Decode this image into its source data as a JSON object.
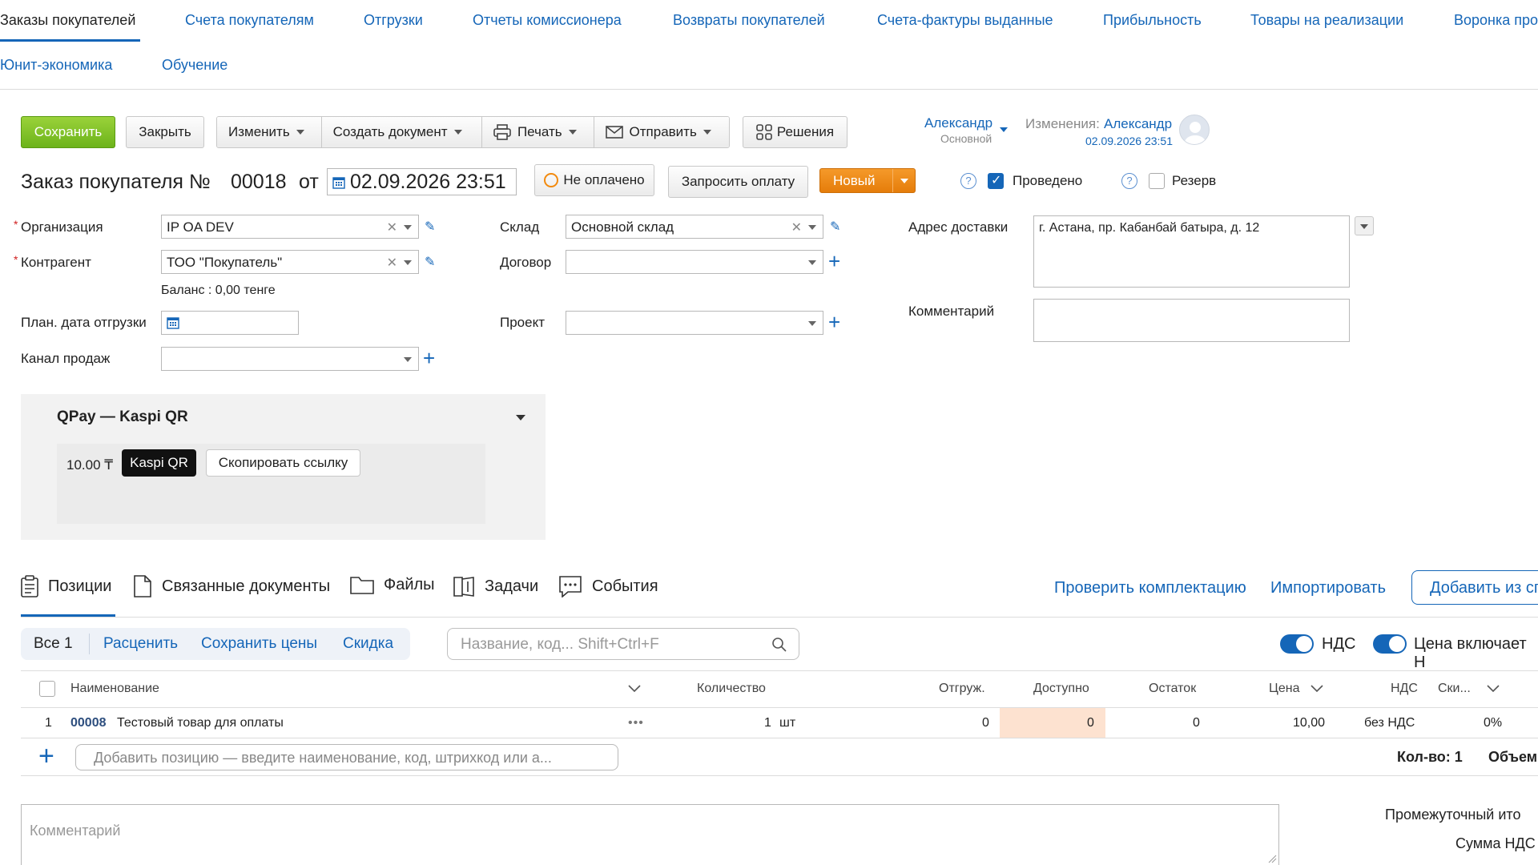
{
  "nav": {
    "row1": [
      "Заказы покупателей",
      "Счета покупателям",
      "Отгрузки",
      "Отчеты комиссионера",
      "Возвраты покупателей",
      "Счета-фактуры выданные",
      "Прибыльность",
      "Товары на реализации",
      "Воронка про"
    ],
    "row2": [
      "Юнит-экономика",
      "Обучение"
    ]
  },
  "toolbar": {
    "save": "Сохранить",
    "close": "Закрыть",
    "change": "Изменить",
    "create_doc": "Создать документ",
    "print": "Печать",
    "send": "Отправить",
    "solutions": "Решения"
  },
  "owner": {
    "name": "Александр",
    "role": "Основной"
  },
  "changes": {
    "label": "Изменения:",
    "user": "Александр",
    "date": "02.09.2026 23:51"
  },
  "header": {
    "title": "Заказ покупателя №",
    "number": "00018",
    "from": "от",
    "date": "02.09.2026 23:51",
    "payment_status": "Не оплачено",
    "request_payment": "Запросить оплату",
    "state": "Новый",
    "posted_label": "Проведено",
    "reserve_label": "Резерв"
  },
  "form": {
    "organization_label": "Организация",
    "organization_value": "IP OA DEV",
    "counterparty_label": "Контрагент",
    "counterparty_value": "ТОО \"Покупатель\"",
    "balance": "Баланс : 0,00 тенге",
    "ship_date_label": "План. дата отгрузки",
    "sales_channel_label": "Канал продаж",
    "warehouse_label": "Склад",
    "warehouse_value": "Основной склад",
    "contract_label": "Договор",
    "project_label": "Проект",
    "address_label": "Адрес доставки",
    "address_value": "г. Астана, пр. Кабанбай батыра, д. 12",
    "comment_label": "Комментарий"
  },
  "qpay": {
    "title": "QPay — Kaspi QR",
    "amount": "10.00 ₸",
    "kaspi_button": "Kaspi QR",
    "copy_button": "Скопировать ссылку"
  },
  "tabs": [
    "Позиции",
    "Связанные документы",
    "Файлы",
    "Задачи",
    "События"
  ],
  "actions": {
    "check": "Проверить комплектацию",
    "import": "Импортировать",
    "add_from": "Добавить из сп"
  },
  "filters": {
    "all": "Все 1",
    "price": "Расценить",
    "save_prices": "Сохранить цены",
    "discount": "Скидка",
    "search_placeholder": "Название, код... Shift+Ctrl+F",
    "vat_label": "НДС",
    "price_includes_label": "Цена включает Н"
  },
  "table": {
    "headers": {
      "name": "Наименование",
      "qty": "Количество",
      "shipped": "Отгруж.",
      "available": "Доступно",
      "remainder": "Остаток",
      "price": "Цена",
      "vat": "НДС",
      "discount": "Ски..."
    },
    "rows": [
      {
        "index": "1",
        "code": "00008",
        "name": "Тестовый товар для оплаты",
        "qty": "1",
        "unit": "шт",
        "shipped": "0",
        "available": "0",
        "remainder": "0",
        "price": "10,00",
        "vat": "без НДС",
        "discount": "0%"
      }
    ],
    "add_placeholder": "Добавить позицию — введите наименование, код, штрихкод или а...",
    "total_qty": "Кол-во: 1",
    "total_volume": "Объем"
  },
  "footer": {
    "comment_placeholder": "Комментарий",
    "subtotal": "Промежуточный ито",
    "vat_sum": "Сумма НДС"
  }
}
